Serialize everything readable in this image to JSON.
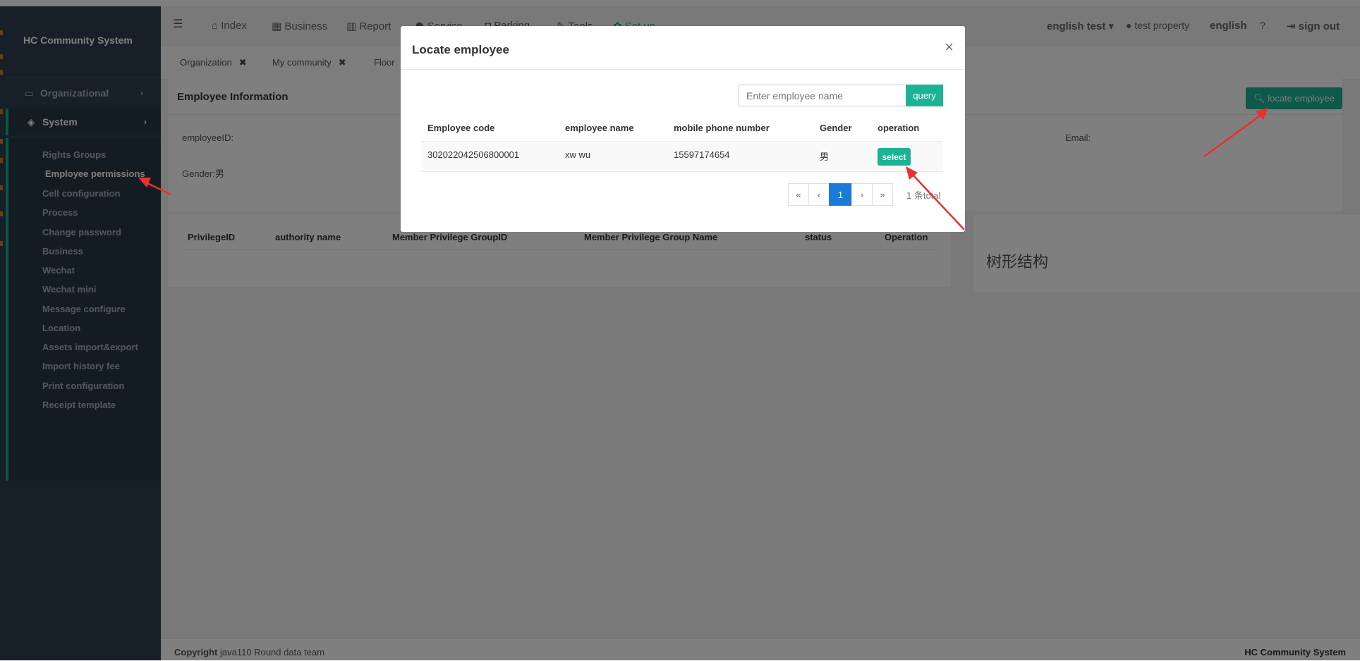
{
  "sidebar": {
    "brand": "HC Community System",
    "organizational": "Organizational",
    "system": "System",
    "items": [
      "Rights Groups",
      "Employee permissions",
      "Cell configuration",
      "Process",
      "Change password",
      "Business",
      "Wechat",
      "Wechat mini",
      "Message configure",
      "Location",
      "Assets import&export",
      "Import history fee",
      "Print configuration",
      "Receipt template"
    ],
    "active_item": "Employee permissions"
  },
  "topnav": {
    "links": [
      "Index",
      "Business",
      "Report",
      "Service",
      "Parking",
      "Tools",
      "Set up"
    ],
    "user": "english test",
    "property": "test property",
    "language": "english",
    "help": "?",
    "signout": "sign out"
  },
  "tabs": [
    "Organization",
    "My community",
    "Floor"
  ],
  "employee_panel": {
    "title": "Employee Information",
    "employee_id_label": "employeeID:",
    "email_label": "Email:",
    "gender_label": "Gender:",
    "gender_value": "男",
    "locate_button": "locate employee"
  },
  "privilege_table": {
    "headers": [
      "PrivilegeID",
      "authority name",
      "Member Privilege GroupID",
      "Member Privilege Group Name",
      "status",
      "Operation"
    ]
  },
  "tree_title": "树形结构",
  "footer": {
    "copyright_label": "Copyright",
    "copyright_text": "java110 Round data team",
    "right": "HC Community System"
  },
  "modal": {
    "title": "Locate employee",
    "close": "×",
    "search_placeholder": "Enter employee name",
    "query_button": "query",
    "headers": [
      "Employee code",
      "employee name",
      "mobile phone number",
      "Gender",
      "operation"
    ],
    "rows": [
      {
        "code": "302022042506800001",
        "name": "xw wu",
        "phone": "15597174654",
        "gender": "男",
        "action": "select"
      }
    ],
    "pagination": {
      "first": "«",
      "prev": "‹",
      "current": "1",
      "next": "›",
      "last": "»"
    },
    "total": "1 条total"
  },
  "colors": {
    "accent": "#1ab394",
    "sidebar": "#2f4050",
    "page_active": "#1a7bd8",
    "arrow": "#e8312f"
  }
}
